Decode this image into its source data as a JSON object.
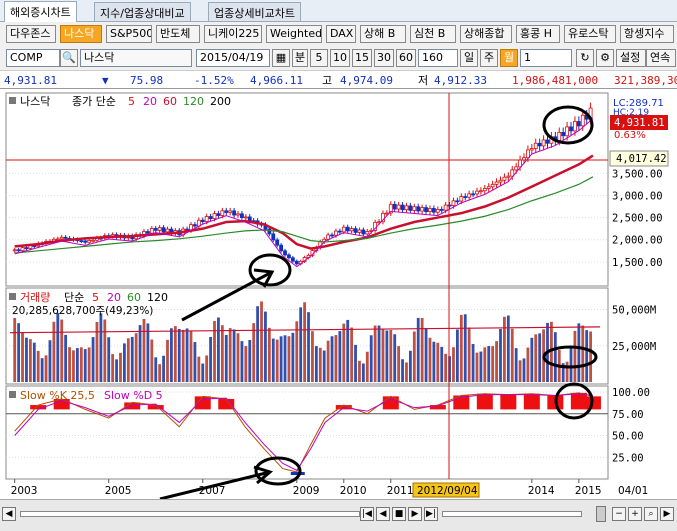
{
  "tabs": [
    "해외증시차트",
    "지수/업종상대비교",
    "업종상세비교차트"
  ],
  "indexButtons": [
    "다우존스",
    "나스닥",
    "S&P500",
    "반도체",
    "니케이225",
    "Weighted",
    "DAX",
    "상해 B",
    "심천 B",
    "상해종합",
    "홍콩 H",
    "유로스탁",
    "항셍지수"
  ],
  "selectedIndex": "나스닥",
  "toolbar": {
    "code": "COMP",
    "name": "나스닥",
    "date": "2015/04/19",
    "period_label": "분",
    "periods": [
      "5",
      "10",
      "15",
      "30",
      "60"
    ],
    "count": "160",
    "day": "일",
    "week": "주",
    "month": "월",
    "step": "1",
    "settings": "설정",
    "continuous": "연속"
  },
  "quote": {
    "price": "4,931.81",
    "arrow": "▼",
    "change": "75.98",
    "pct": "-1.52%",
    "high_label": "고",
    "open": "4,966.11",
    "high": "4,974.09",
    "low_label": "저",
    "low": "4,912.33",
    "volume": "1,986,481,000",
    "amount": "321,389,30"
  },
  "colors": {
    "up": "#d81010",
    "down": "#1030c0",
    "ma5": "#d81010",
    "ma20": "#c000c0",
    "ma60": "#c8102e",
    "ma120": "#2a8a2a",
    "ma200": "#000000",
    "annotation": "#000000",
    "accent": "#f5a623"
  },
  "price_panel": {
    "title": "나스닥",
    "ma_label": "종가 단순",
    "ma_periods": [
      "5",
      "20",
      "60",
      "120",
      "200"
    ],
    "last_price": "4,931.81",
    "last_pct": "0.63%",
    "crosshair_value": "4,017.42",
    "lc_label": "LC:289.71",
    "hc_label": "HC:2.19"
  },
  "volume_panel": {
    "title": "거래량",
    "ma_label": "단순",
    "ma_periods": [
      "5",
      "20",
      "60",
      "120"
    ],
    "value_text": "20,285,628,700주(49,23%)"
  },
  "stoch_panel": {
    "title": "Slow %K 25,5",
    "d_label": "Slow %D 5"
  },
  "date_cursor": "2012/09/04",
  "date_end": "04/01",
  "chart_data": [
    {
      "type": "candlestick",
      "title": "나스닥",
      "yaxis_ticks": [
        "3,500.00",
        "3,000.00",
        "2,500.00",
        "2,000.00",
        "1,500.00"
      ],
      "ylim": [
        1000,
        5200
      ],
      "x_ticks": [
        "2003",
        "2005",
        "2007",
        "2009",
        "2010",
        "2011",
        "2012/09/04",
        "2014",
        "2015",
        "04/01"
      ],
      "x": [
        2003.0,
        2003.5,
        2004.0,
        2004.5,
        2005.0,
        2005.5,
        2006.0,
        2006.5,
        2007.0,
        2007.5,
        2007.9,
        2008.3,
        2008.7,
        2009.0,
        2009.3,
        2009.6,
        2010.0,
        2010.5,
        2011.0,
        2011.5,
        2012.0,
        2012.5,
        2013.0,
        2013.5,
        2014.0,
        2014.5,
        2015.0,
        2015.3
      ],
      "close": [
        1750,
        1900,
        2050,
        1950,
        2100,
        2050,
        2250,
        2150,
        2450,
        2650,
        2500,
        2300,
        1700,
        1450,
        1700,
        2050,
        2250,
        2150,
        2750,
        2700,
        2650,
        2950,
        3150,
        3450,
        4100,
        4300,
        4650,
        4931.81
      ],
      "ma": [
        {
          "name": "60",
          "values": [
            1850,
            1900,
            1980,
            2030,
            2060,
            2080,
            2120,
            2160,
            2250,
            2400,
            2420,
            2350,
            2150,
            1900,
            1800,
            1850,
            1950,
            2050,
            2250,
            2400,
            2500,
            2600,
            2750,
            2950,
            3200,
            3450,
            3700,
            3900
          ]
        },
        {
          "name": "120",
          "values": [
            1700,
            1750,
            1800,
            1850,
            1900,
            1950,
            1980,
            2020,
            2080,
            2150,
            2200,
            2220,
            2180,
            2080,
            1980,
            1950,
            1980,
            2030,
            2150,
            2250,
            2330,
            2420,
            2530,
            2680,
            2880,
            3050,
            3250,
            3420
          ]
        }
      ]
    },
    {
      "type": "bar",
      "title": "거래량",
      "yaxis_ticks": [
        "50,000M",
        "25,000M"
      ],
      "ylim": [
        0,
        60000
      ]
    },
    {
      "type": "line",
      "title": "Slow %K 25,5",
      "yaxis_ticks": [
        "100.00",
        "75.00",
        "50.00",
        "25.00"
      ],
      "ylim": [
        0,
        100
      ],
      "x": [
        2003.0,
        2003.5,
        2004.0,
        2004.5,
        2005.0,
        2005.5,
        2006.0,
        2006.5,
        2007.0,
        2007.5,
        2007.9,
        2008.3,
        2008.7,
        2009.0,
        2009.3,
        2009.6,
        2010.0,
        2010.5,
        2011.0,
        2011.5,
        2012.0,
        2012.5,
        2013.0,
        2013.5,
        2014.0,
        2014.5,
        2015.0,
        2015.3
      ],
      "k": [
        55,
        85,
        92,
        80,
        70,
        88,
        85,
        60,
        95,
        92,
        60,
        35,
        12,
        8,
        40,
        70,
        85,
        75,
        95,
        80,
        85,
        96,
        98,
        97,
        98,
        96,
        99,
        95
      ],
      "d": [
        50,
        80,
        90,
        82,
        72,
        85,
        86,
        65,
        92,
        93,
        65,
        40,
        18,
        10,
        35,
        65,
        82,
        78,
        92,
        82,
        84,
        94,
        97,
        97,
        97,
        96,
        98,
        96
      ]
    }
  ]
}
